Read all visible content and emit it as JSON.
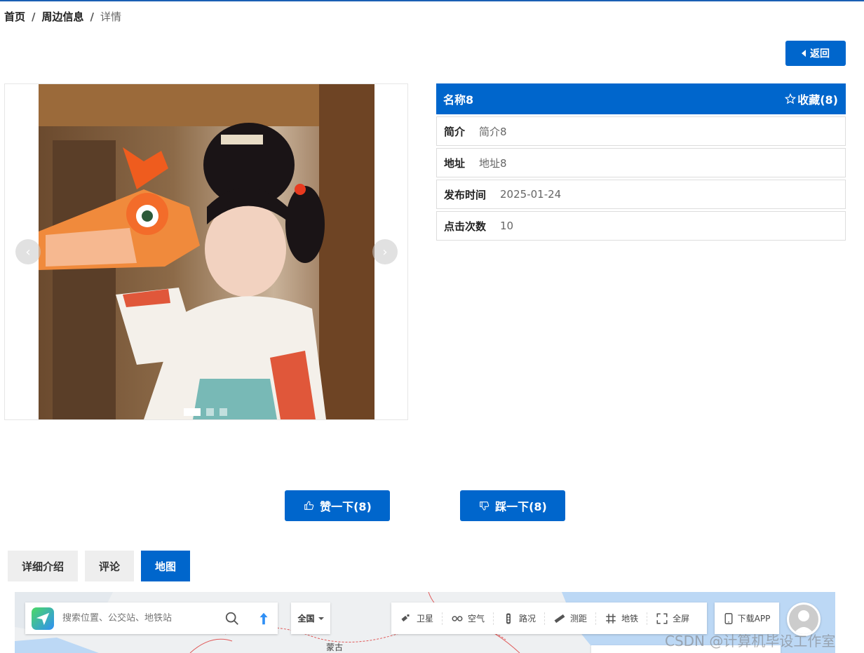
{
  "breadcrumb": {
    "home": "首页",
    "section": "周边信息",
    "current": "详情",
    "separator": "/"
  },
  "back_button": {
    "label": "返回"
  },
  "carousel": {
    "prev": "‹",
    "next": "›",
    "slides": 3,
    "active_slide": 1
  },
  "info": {
    "title": "名称8",
    "favorite_label": "收藏(8)",
    "rows": [
      {
        "label": "简介",
        "value": "简介8"
      },
      {
        "label": "地址",
        "value": "地址8"
      },
      {
        "label": "发布时间",
        "value": "2025-01-24"
      },
      {
        "label": "点击次数",
        "value": "10"
      }
    ]
  },
  "votes": {
    "like_label": "赞一下(8)",
    "dislike_label": "踩一下(8)"
  },
  "tabs": [
    {
      "label": "详细介绍",
      "active": false
    },
    {
      "label": "评论",
      "active": false
    },
    {
      "label": "地图",
      "active": true
    }
  ],
  "map": {
    "search_placeholder": "搜索位置、公交站、地铁站",
    "region": "全国",
    "tools": [
      {
        "label": "卫星",
        "icon": "satellite-icon"
      },
      {
        "label": "空气",
        "icon": "air-icon"
      },
      {
        "label": "路况",
        "icon": "traffic-icon"
      },
      {
        "label": "测距",
        "icon": "ruler-icon"
      },
      {
        "label": "地铁",
        "icon": "subway-icon"
      },
      {
        "label": "全屏",
        "icon": "fullscreen-icon"
      }
    ],
    "download_label": "下载APP",
    "place_label": "蒙古"
  },
  "watermark": "CSDN @计算机毕设工作室",
  "colors": {
    "primary": "#0066cc",
    "tab_inactive": "#eeeeee",
    "border": "#dddddd"
  }
}
